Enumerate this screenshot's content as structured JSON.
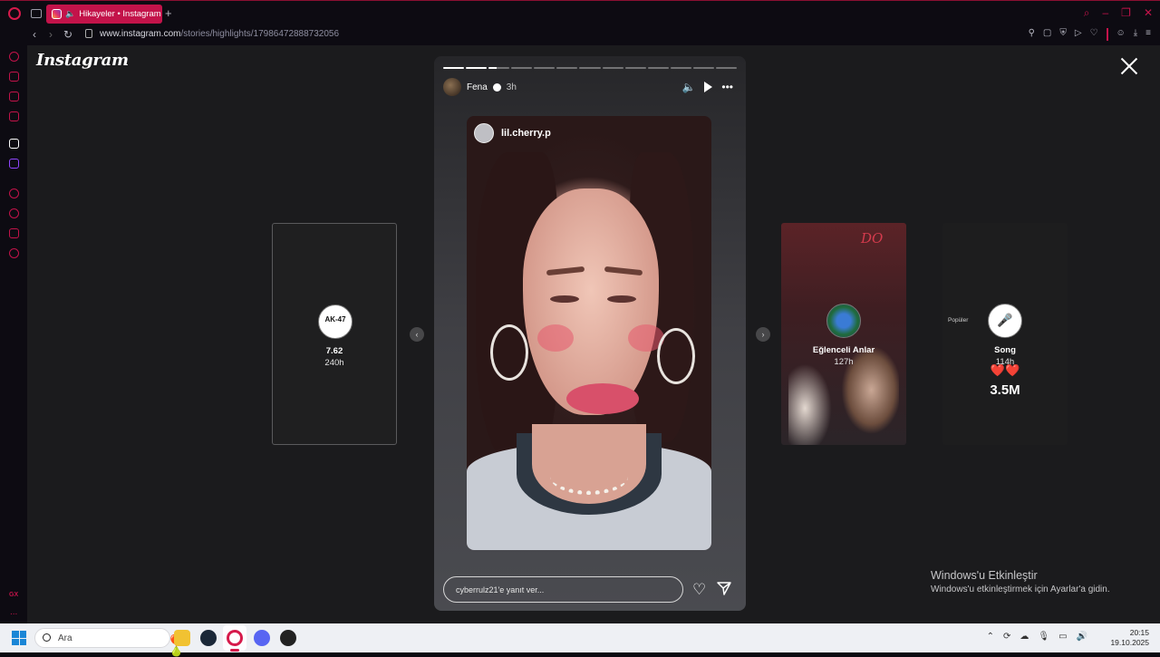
{
  "browser": {
    "tab_title": "Hikayeler • Instagram",
    "new_tab": "+",
    "url_domain": "www.instagram.com",
    "url_path": "/stories/highlights/17986472888732056"
  },
  "viewer": {
    "logo": "Instagram",
    "close_label": "✕"
  },
  "story": {
    "username": "Fena",
    "time_ago": "3h",
    "mention": "lil.cherry.p",
    "reply_placeholder": "cyberrulz21'e yanıt ver...",
    "progress_total_segments": 13,
    "progress_completed_segments": 2,
    "progress_current_fraction": 0.4
  },
  "highlights": [
    {
      "name": "7.62",
      "time": "240h",
      "badge": "AK-47"
    },
    {
      "name": "Eğlenceli Anlar",
      "time": "127h",
      "overlay": "DO"
    },
    {
      "name": "Song",
      "time": "114h",
      "popular": "Popüler",
      "hearts": "❤️❤️",
      "stat": "3.5M"
    }
  ],
  "windows_activation": {
    "title": "Windows'u Etkinleştir",
    "subtitle": "Windows'u etkinleştirmek için Ayarlar'a gidin."
  },
  "taskbar": {
    "search_placeholder": "Ara",
    "time": "20:15",
    "date": "19.10.2025"
  },
  "sidebar": {
    "gx_label": "GX",
    "more": "..."
  },
  "colors": {
    "accent": "#c3134a",
    "viewer_bg": "#1b1b1d"
  }
}
